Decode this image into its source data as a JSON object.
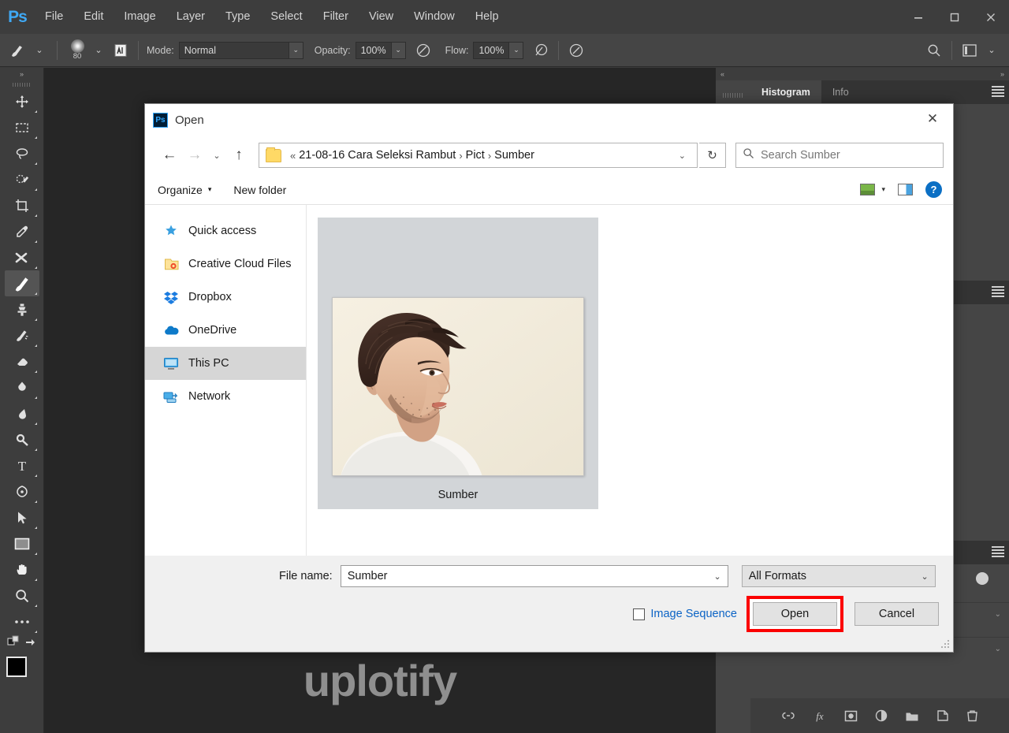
{
  "app": {
    "name": "Photoshop",
    "logo_text": "Ps",
    "menus": [
      "File",
      "Edit",
      "Image",
      "Layer",
      "Type",
      "Select",
      "Filter",
      "View",
      "Window",
      "Help"
    ],
    "window_controls": {
      "minimize": "—",
      "maximize": "❑",
      "close": "✕"
    }
  },
  "options_bar": {
    "brush_size": "80",
    "mode_label": "Mode:",
    "mode_value": "Normal",
    "opacity_label": "Opacity:",
    "opacity_value": "100%",
    "flow_label": "Flow:",
    "flow_value": "100%",
    "caret": "⌄"
  },
  "toolbar": {
    "tools": [
      {
        "name": "move-tool",
        "active": false
      },
      {
        "name": "rectangular-marquee-tool",
        "active": false
      },
      {
        "name": "lasso-tool",
        "active": false
      },
      {
        "name": "quick-selection-tool",
        "active": false
      },
      {
        "name": "crop-tool",
        "active": false
      },
      {
        "name": "eyedropper-tool",
        "active": false
      },
      {
        "name": "healing-brush-tool",
        "active": false
      },
      {
        "name": "brush-tool",
        "active": true
      },
      {
        "name": "clone-stamp-tool",
        "active": false
      },
      {
        "name": "history-brush-tool",
        "active": false
      },
      {
        "name": "eraser-tool",
        "active": false
      },
      {
        "name": "gradient-tool",
        "active": false
      },
      {
        "name": "blur-tool",
        "active": false
      },
      {
        "name": "dodge-tool",
        "active": false
      },
      {
        "name": "type-tool",
        "active": false
      },
      {
        "name": "pen-tool",
        "active": false
      },
      {
        "name": "path-selection-tool",
        "active": false
      },
      {
        "name": "rectangle-tool",
        "active": false
      },
      {
        "name": "hand-tool",
        "active": false
      },
      {
        "name": "zoom-tool",
        "active": false
      },
      {
        "name": "more-tools",
        "active": false
      }
    ],
    "foreground_color": "#000000",
    "background_color": "#ffffff"
  },
  "canvas": {
    "background_color": "#262626",
    "watermark": "uplotify"
  },
  "panels": {
    "collapse_left": "«",
    "collapse_right": "»",
    "tabs": [
      {
        "label": "Histogram",
        "active": true
      },
      {
        "label": "Info",
        "active": false
      }
    ],
    "layer_buttons": [
      "link-layers",
      "add-layer-style",
      "add-layer-mask",
      "new-adjustment-layer",
      "new-group",
      "new-layer",
      "delete-layer"
    ]
  },
  "dialog": {
    "title": "Open",
    "app_badge": "Ps",
    "close_glyph": "✕",
    "nav": {
      "back": "←",
      "forward": "→",
      "recent": "⌄",
      "up": "↑"
    },
    "breadcrumb": {
      "overflow": "«",
      "segments": [
        "21-08-16 Cara Seleksi Rambut",
        "Pict",
        "Sumber"
      ],
      "separator": "›",
      "dropdown_caret": "⌄"
    },
    "refresh_glyph": "↻",
    "search": {
      "placeholder": "Search Sumber",
      "icon": "search-icon"
    },
    "toolbar": {
      "organize": "Organize",
      "organize_caret": "▾",
      "new_folder": "New folder",
      "view_caret": "▾",
      "help": "?"
    },
    "sidebar": [
      {
        "label": "Quick access",
        "icon": "star-pin-icon",
        "selected": false
      },
      {
        "label": "Creative Cloud Files",
        "icon": "creative-cloud-icon",
        "selected": false
      },
      {
        "label": "Dropbox",
        "icon": "dropbox-icon",
        "selected": false
      },
      {
        "label": "OneDrive",
        "icon": "onedrive-cloud-icon",
        "selected": false
      },
      {
        "label": "This PC",
        "icon": "monitor-icon",
        "selected": true
      },
      {
        "label": "Network",
        "icon": "network-icon",
        "selected": false
      }
    ],
    "files": [
      {
        "label": "Sumber",
        "selected": true,
        "type": "image"
      }
    ],
    "footer": {
      "file_name_label": "File name:",
      "file_name_value": "Sumber",
      "file_name_caret": "⌄",
      "format_value": "All Formats",
      "format_caret": "⌄",
      "image_sequence_label": "Image Sequence",
      "image_sequence_checked": false,
      "open_button": "Open",
      "cancel_button": "Cancel",
      "highlight_color": "#fb0000"
    }
  }
}
